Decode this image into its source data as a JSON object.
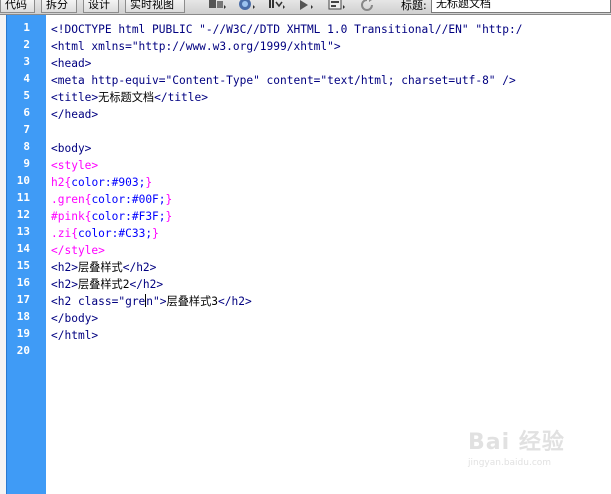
{
  "toolbar": {
    "tabs": [
      {
        "label": "代码"
      },
      {
        "label": "拆分"
      },
      {
        "label": "设计"
      },
      {
        "label": "实时视图"
      }
    ],
    "icons": [
      "multiscreen-icon",
      "preview-browser-icon",
      "file-management-icon",
      "debug-icon",
      "visual-aids-icon",
      "refresh-icon"
    ],
    "title_label": "标题:",
    "title_value": "无标题文档"
  },
  "editor": {
    "line_numbers": [
      "1",
      "2",
      "3",
      "4",
      "5",
      "6",
      "7",
      "8",
      "9",
      "10",
      "11",
      "12",
      "13",
      "14",
      "15",
      "16",
      "17",
      "18",
      "19",
      "20"
    ],
    "lines": [
      [
        {
          "t": "<!DOCTYPE html PUBLIC \"-//W3C//DTD XHTML 1.0 Transitional//EN\" \"http:/",
          "c": "tag"
        }
      ],
      [
        {
          "t": "<html xmlns=\"http://www.w3.org/1999/xhtml\">",
          "c": "tag"
        }
      ],
      [
        {
          "t": "<head>",
          "c": "tag"
        }
      ],
      [
        {
          "t": "<meta http-equiv=\"Content-Type\" content=\"text/html; charset=utf-8\" />",
          "c": "tag"
        }
      ],
      [
        {
          "t": "<title>",
          "c": "tag"
        },
        {
          "t": "无标题文档",
          "c": "txt"
        },
        {
          "t": "</title>",
          "c": "tag"
        }
      ],
      [
        {
          "t": "</head>",
          "c": "tag"
        }
      ],
      [],
      [
        {
          "t": "<body>",
          "c": "tag"
        }
      ],
      [
        {
          "t": "<style>",
          "c": "css-sel"
        }
      ],
      [
        {
          "t": "h2",
          "c": "css-sel"
        },
        {
          "t": "{",
          "c": "css-sel"
        },
        {
          "t": "color:#903;",
          "c": "css-prop"
        },
        {
          "t": "}",
          "c": "css-sel"
        }
      ],
      [
        {
          "t": ".gren",
          "c": "css-sel"
        },
        {
          "t": "{",
          "c": "css-sel"
        },
        {
          "t": "color:#00F;",
          "c": "css-prop"
        },
        {
          "t": "}",
          "c": "css-sel"
        }
      ],
      [
        {
          "t": "#pink",
          "c": "css-sel"
        },
        {
          "t": "{",
          "c": "css-sel"
        },
        {
          "t": "color:#F3F;",
          "c": "css-prop"
        },
        {
          "t": "}",
          "c": "css-sel"
        }
      ],
      [
        {
          "t": ".zi",
          "c": "css-sel"
        },
        {
          "t": "{",
          "c": "css-sel"
        },
        {
          "t": "color:#C33;",
          "c": "css-prop"
        },
        {
          "t": "}",
          "c": "css-sel"
        }
      ],
      [
        {
          "t": "</style>",
          "c": "css-sel"
        }
      ],
      [
        {
          "t": "<h2>",
          "c": "tag"
        },
        {
          "t": "层叠样式",
          "c": "txt"
        },
        {
          "t": "</h2>",
          "c": "tag"
        }
      ],
      [
        {
          "t": "<h2>",
          "c": "tag"
        },
        {
          "t": "层叠样式2",
          "c": "txt"
        },
        {
          "t": "</h2>",
          "c": "tag"
        }
      ],
      [
        {
          "t": "<h2 class=\"gre",
          "c": "tag"
        },
        {
          "caret": true
        },
        {
          "t": "n\">",
          "c": "tag"
        },
        {
          "t": "层叠样式3",
          "c": "txt"
        },
        {
          "t": "</h2>",
          "c": "tag"
        }
      ],
      [
        {
          "t": "</body>",
          "c": "tag"
        }
      ],
      [
        {
          "t": "</html>",
          "c": "tag"
        }
      ],
      []
    ]
  },
  "watermark": {
    "logo_text": "Bai 经验",
    "url_text": "jingyan.baidu.com"
  },
  "colors": {
    "gutter": "#3f9bf6",
    "tag": "#000080",
    "css": "#ff00ff",
    "css_value": "#0000ff"
  }
}
